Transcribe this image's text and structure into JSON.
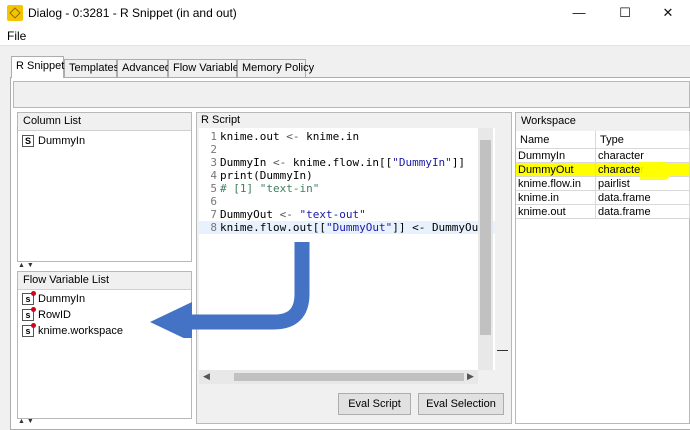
{
  "window": {
    "title": "Dialog - 0:3281 - R Snippet (in and out)",
    "minimize": "—",
    "maximize": "☐",
    "close": "✕"
  },
  "menu": {
    "file": "File"
  },
  "tabs": [
    "R Snippet",
    "Templates",
    "Advanced",
    "Flow Variables",
    "Memory Policy"
  ],
  "column_list": {
    "title": "Column List",
    "items": [
      {
        "icon": "S",
        "label": "DummyIn"
      }
    ]
  },
  "flow_variable_list": {
    "title": "Flow Variable List",
    "items": [
      {
        "icon": "s",
        "label": "DummyIn"
      },
      {
        "icon": "s",
        "label": "RowID"
      },
      {
        "icon": "s",
        "label": "knime.workspace"
      }
    ]
  },
  "r_script": {
    "title": "R Script",
    "lines": [
      {
        "n": "1",
        "a": "knime.out ",
        "op": "<-",
        "b": " knime.in",
        "s": "",
        "c": ""
      },
      {
        "n": "2",
        "a": "",
        "op": "",
        "b": "",
        "s": "",
        "c": ""
      },
      {
        "n": "3",
        "a": "DummyIn ",
        "op": "<-",
        "b": " knime.flow.in[[",
        "s": "\"DummyIn\"",
        "c": "]]"
      },
      {
        "n": "4",
        "a": "print(DummyIn)",
        "op": "",
        "b": "",
        "s": "",
        "c": ""
      },
      {
        "n": "5",
        "a": "",
        "op": "",
        "b": "",
        "s": "",
        "c": "",
        "comment": "# [1] \"text-in\""
      },
      {
        "n": "6",
        "a": "",
        "op": "",
        "b": "",
        "s": "",
        "c": ""
      },
      {
        "n": "7",
        "a": "DummyOut ",
        "op": "<-",
        "b": " ",
        "s": "\"text-out\"",
        "c": ""
      },
      {
        "n": "8",
        "a": "knime.flow.out[[",
        "op": "",
        "b": "",
        "s": "\"DummyOut\"",
        "c": "]] <- DummyOut"
      }
    ]
  },
  "buttons": {
    "eval_script": "Eval Script",
    "eval_selection": "Eval Selection"
  },
  "workspace": {
    "title": "Workspace",
    "columns": [
      "Name",
      "Type"
    ],
    "rows": [
      {
        "name": "DummyIn",
        "type": "character",
        "highlight": false
      },
      {
        "name": "DummyOut",
        "type": "character",
        "highlight": true
      },
      {
        "name": "knime.flow.in",
        "type": "pairlist",
        "highlight": false
      },
      {
        "name": "knime.in",
        "type": "data.frame",
        "highlight": false
      },
      {
        "name": "knime.out",
        "type": "data.frame",
        "highlight": false
      }
    ]
  },
  "colors": {
    "highlight": "#ffff00",
    "annotation_arrow": "#4472c4",
    "string": "#1a1aa6",
    "comment": "#3f7f5f"
  },
  "icons": [
    "knime-app-icon",
    "minimize-icon",
    "maximize-icon",
    "close-icon",
    "column-string-icon",
    "flow-variable-string-icon",
    "annotation-arrow-icon"
  ]
}
